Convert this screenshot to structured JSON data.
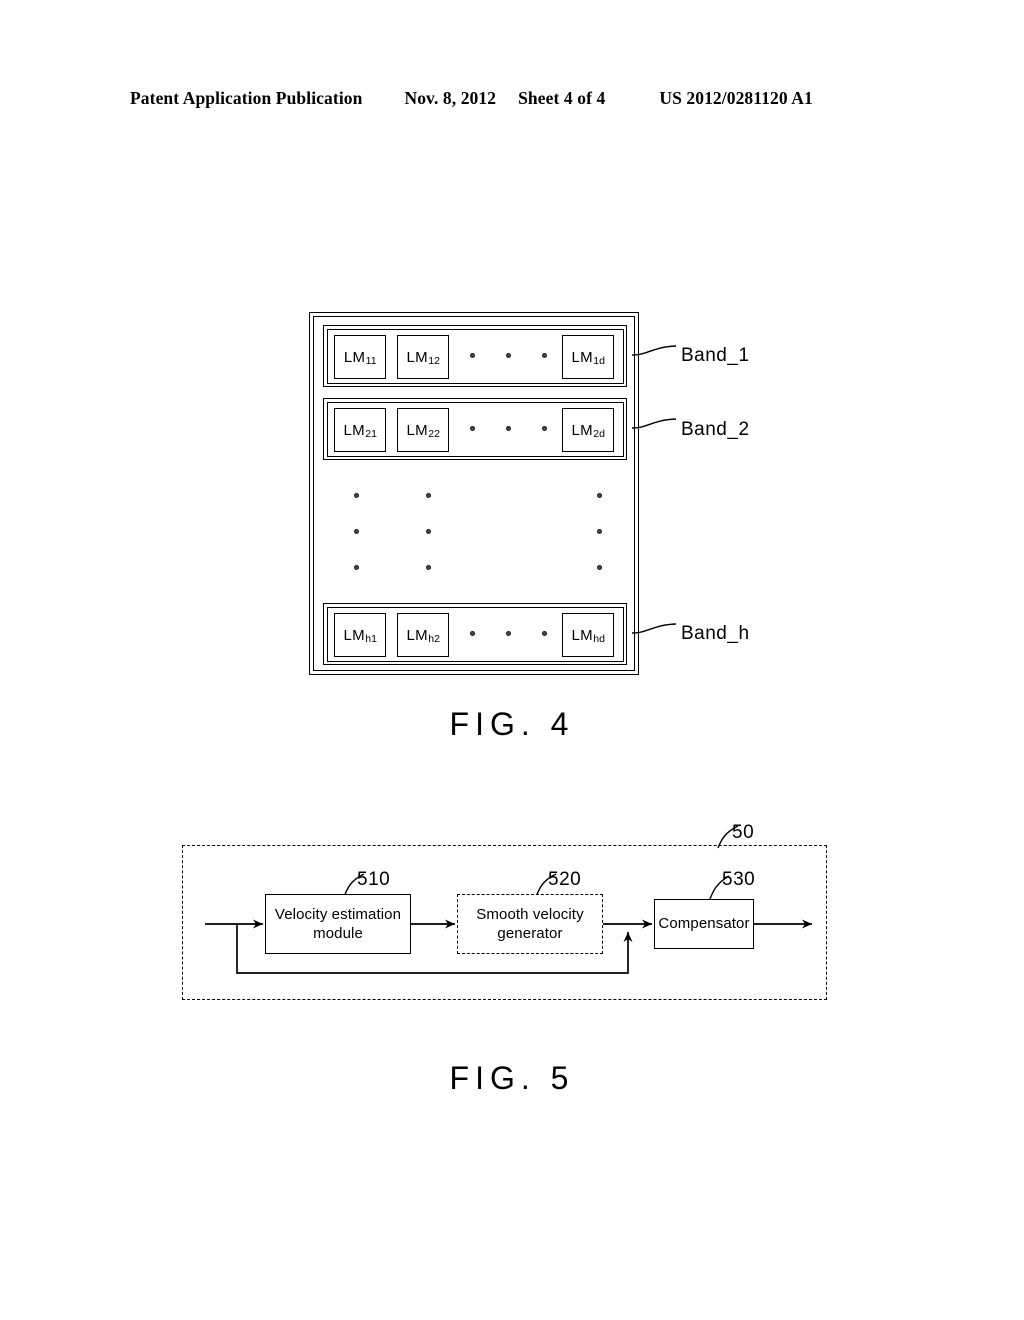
{
  "header": {
    "publication": "Patent Application Publication",
    "date": "Nov. 8, 2012",
    "sheet": "Sheet 4 of 4",
    "patent_number": "US 2012/0281120 A1"
  },
  "figures": [
    {
      "id": "fig4",
      "caption": "FIG. 4",
      "type": "block-array-diagram",
      "bands": [
        {
          "label": "Band_1",
          "cells": [
            "LM",
            "LM",
            "LM"
          ],
          "cell_labels": [
            {
              "base": "LM",
              "sub": "11"
            },
            {
              "base": "LM",
              "sub": "12"
            },
            {
              "base": "LM",
              "sub": "1d"
            }
          ],
          "ellipsis_count": 3
        },
        {
          "label": "Band_2",
          "cell_labels": [
            {
              "base": "LM",
              "sub": "21"
            },
            {
              "base": "LM",
              "sub": "22"
            },
            {
              "base": "LM",
              "sub": "2d"
            }
          ],
          "ellipsis_count": 3
        },
        {
          "label": "Band_h",
          "cell_labels": [
            {
              "base": "LM",
              "sub": "h1"
            },
            {
              "base": "LM",
              "sub": "h2"
            },
            {
              "base": "LM",
              "sub": "hd"
            }
          ],
          "ellipsis_count": 3
        }
      ],
      "vertical_ellipsis_columns": 3,
      "vertical_ellipsis_dots_per_column": 3
    },
    {
      "id": "fig5",
      "caption": "FIG. 5",
      "type": "block-flow-diagram",
      "system_ref": "50",
      "blocks": [
        {
          "ref": "510",
          "label": "Velocity estimation module",
          "line1": "Velocity estimation",
          "line2": "module",
          "border": "solid"
        },
        {
          "ref": "520",
          "label": "Smooth velocity generator",
          "line1": "Smooth  velocity",
          "line2": "generator",
          "border": "dashed"
        },
        {
          "ref": "530",
          "label": "Compensator",
          "line1": "Compensator",
          "line2": "",
          "border": "solid"
        }
      ],
      "connections": [
        {
          "from": "input",
          "to": "510"
        },
        {
          "from": "510",
          "to": "520"
        },
        {
          "from": "520",
          "to": "530"
        },
        {
          "from": "530",
          "to": "output"
        },
        {
          "from": "input-tap",
          "to": "520-530-junction",
          "style": "feedback"
        }
      ]
    }
  ],
  "colors": {
    "ink": "#000000",
    "paper": "#ffffff",
    "dot": "#4a4a4a"
  }
}
